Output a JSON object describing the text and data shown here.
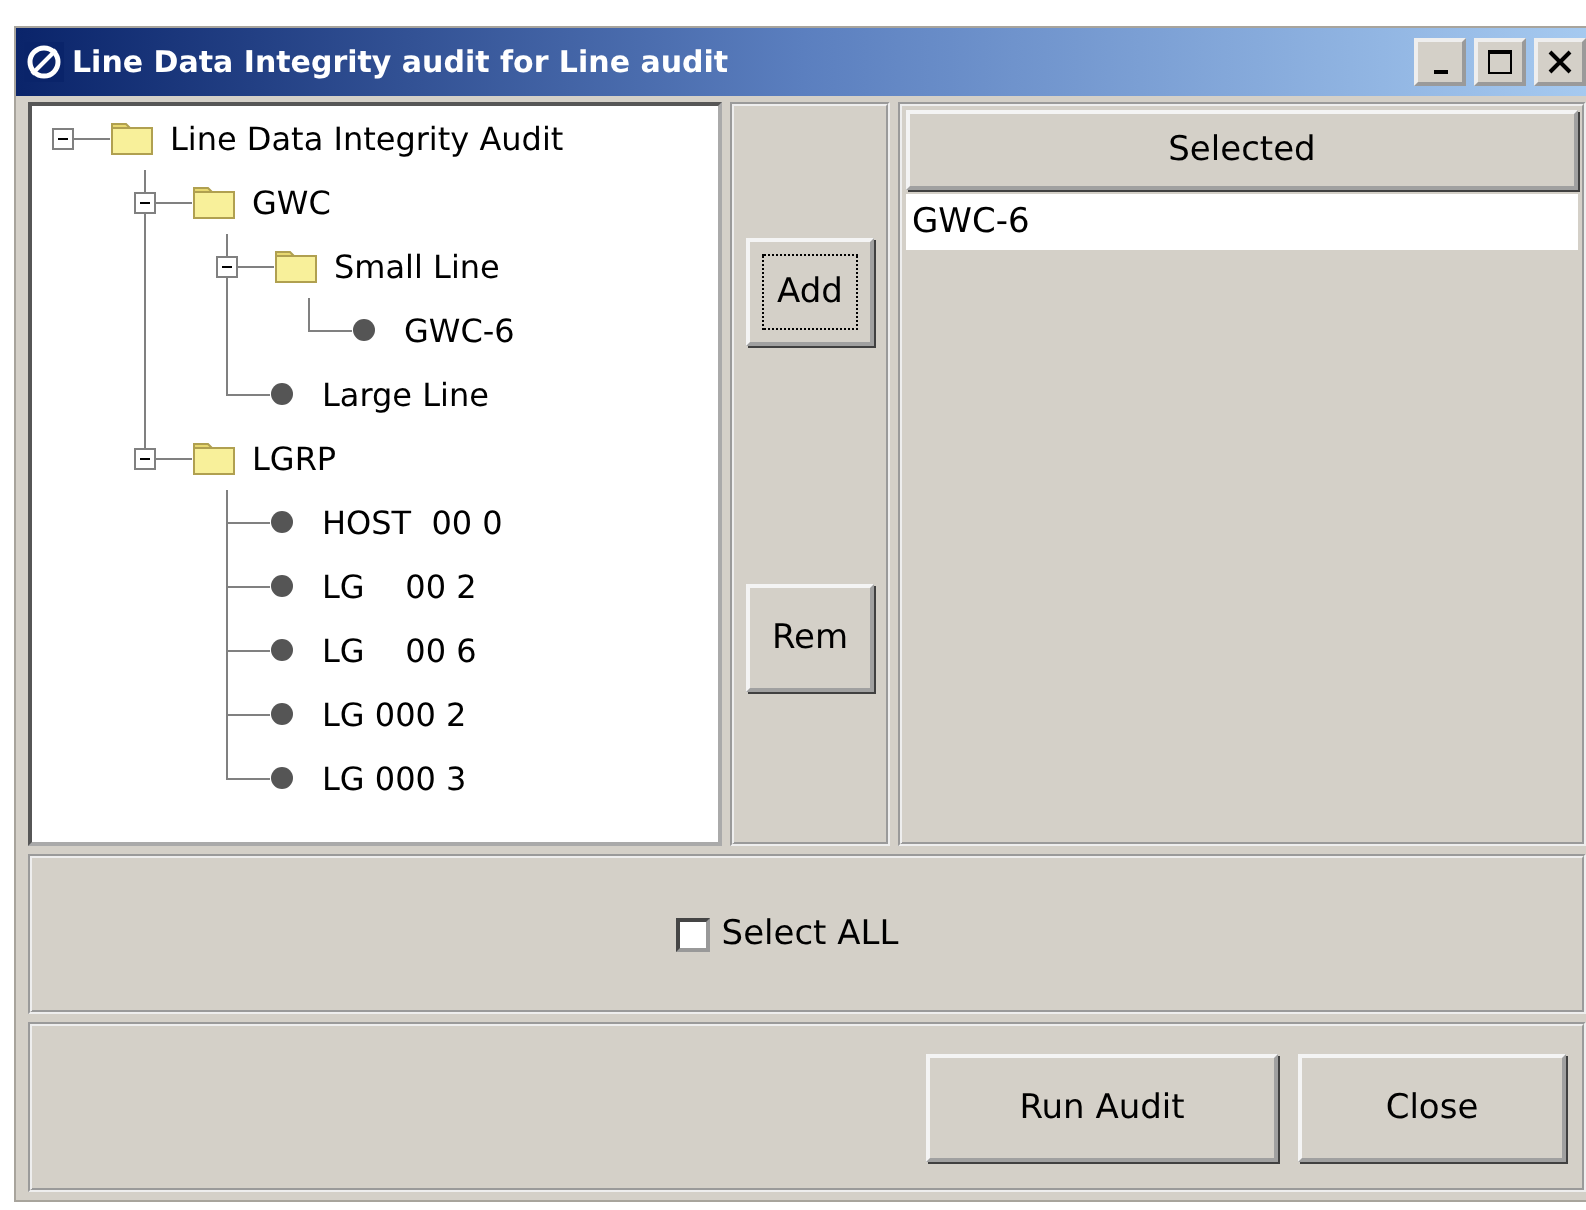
{
  "window": {
    "title": "Line Data Integrity audit for Line audit"
  },
  "tree": [
    {
      "label": "Line Data Integrity Audit",
      "kind": "folder",
      "expanded": true,
      "children": [
        {
          "label": "GWC",
          "kind": "folder",
          "expanded": true,
          "children": [
            {
              "label": "Small Line",
              "kind": "folder",
              "expanded": true,
              "children": [
                {
                  "label": "GWC-6",
                  "kind": "leaf"
                }
              ]
            },
            {
              "label": "Large Line",
              "kind": "leaf"
            }
          ]
        },
        {
          "label": "LGRP",
          "kind": "folder",
          "expanded": true,
          "children": [
            {
              "label": "HOST  00 0",
              "kind": "leaf"
            },
            {
              "label": "LG    00 2",
              "kind": "leaf"
            },
            {
              "label": "LG    00 6",
              "kind": "leaf"
            },
            {
              "label": "LG 000 2",
              "kind": "leaf"
            },
            {
              "label": "LG 000 3",
              "kind": "leaf"
            }
          ]
        }
      ]
    }
  ],
  "move_buttons": [
    {
      "label": "Add",
      "focused": true
    },
    {
      "label": "Rem",
      "focused": false
    }
  ],
  "selected_list": {
    "header": "Selected",
    "rows": [
      "GWC-6"
    ]
  },
  "select_all": {
    "label": "Select ALL",
    "checked": false
  },
  "buttons": [
    "Run Audit",
    "Close"
  ]
}
